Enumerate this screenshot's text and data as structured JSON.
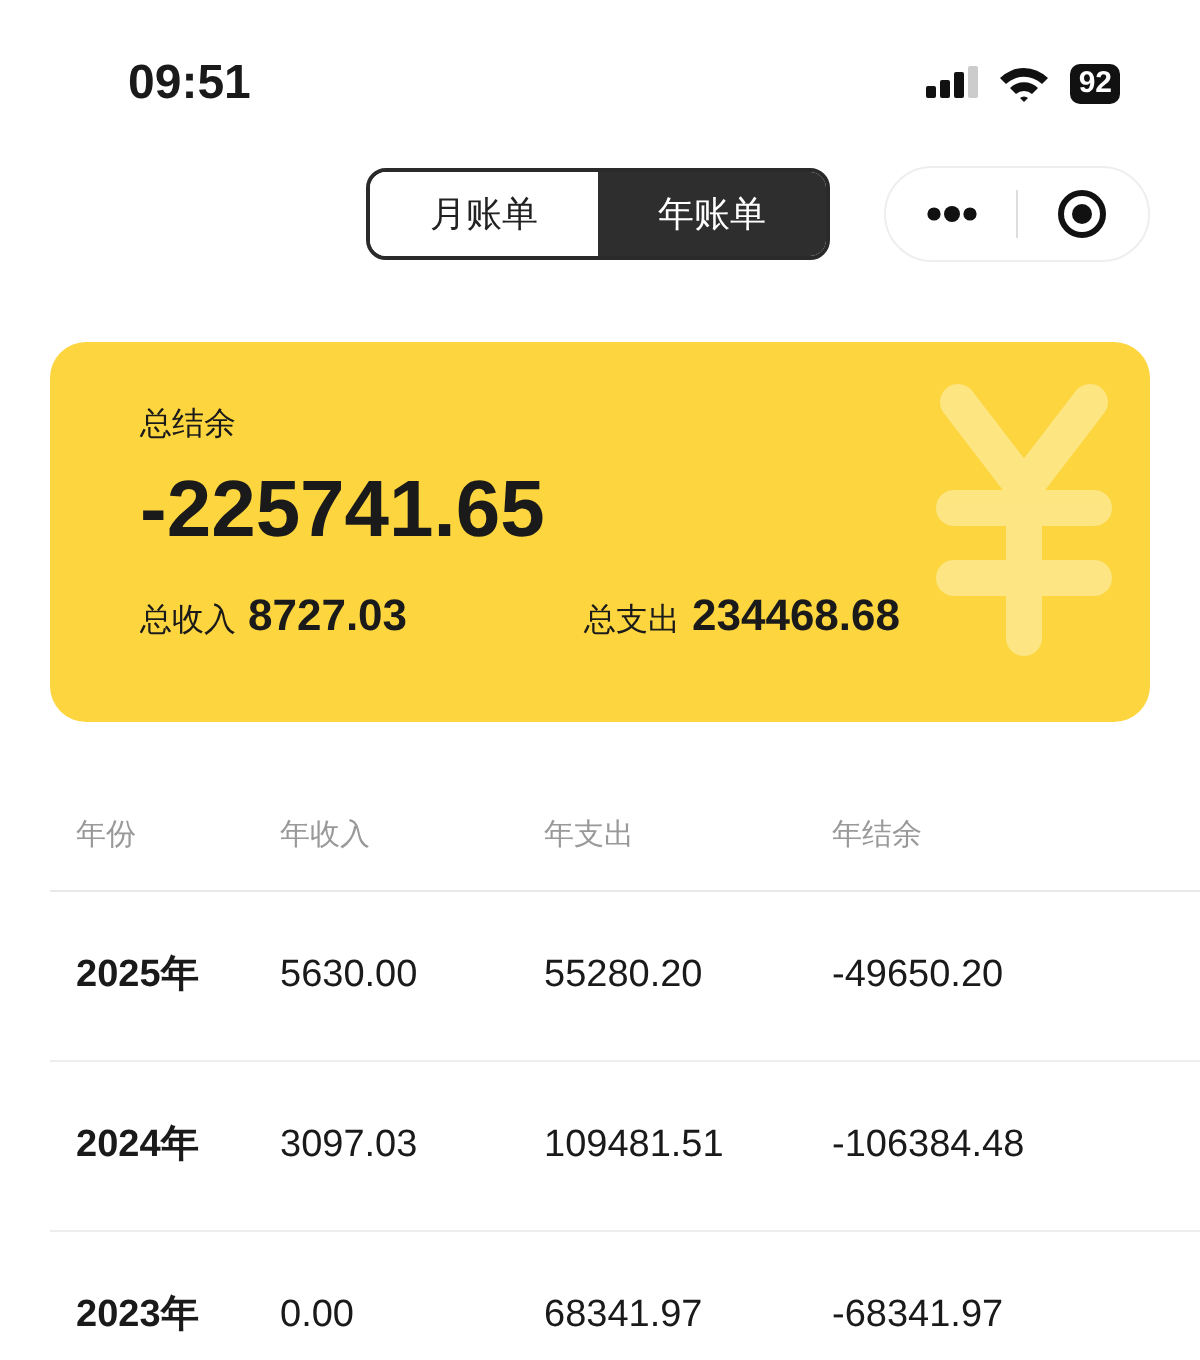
{
  "status_bar": {
    "time": "09:51",
    "battery": "92"
  },
  "tabs": [
    {
      "label": "月账单",
      "selected": false
    },
    {
      "label": "年账单",
      "selected": true
    }
  ],
  "summary": {
    "balance_label": "总结余",
    "balance": "-225741.65",
    "income_label": "总收入",
    "income": "8727.03",
    "expense_label": "总支出",
    "expense": "234468.68"
  },
  "table": {
    "columns": [
      "年份",
      "年收入",
      "年支出",
      "年结余"
    ],
    "rows": [
      [
        "2025年",
        "5630.00",
        "55280.20",
        "-49650.20"
      ],
      [
        "2024年",
        "3097.03",
        "109481.51",
        "-106384.48"
      ],
      [
        "2023年",
        "0.00",
        "68341.97",
        "-68341.97"
      ]
    ]
  }
}
